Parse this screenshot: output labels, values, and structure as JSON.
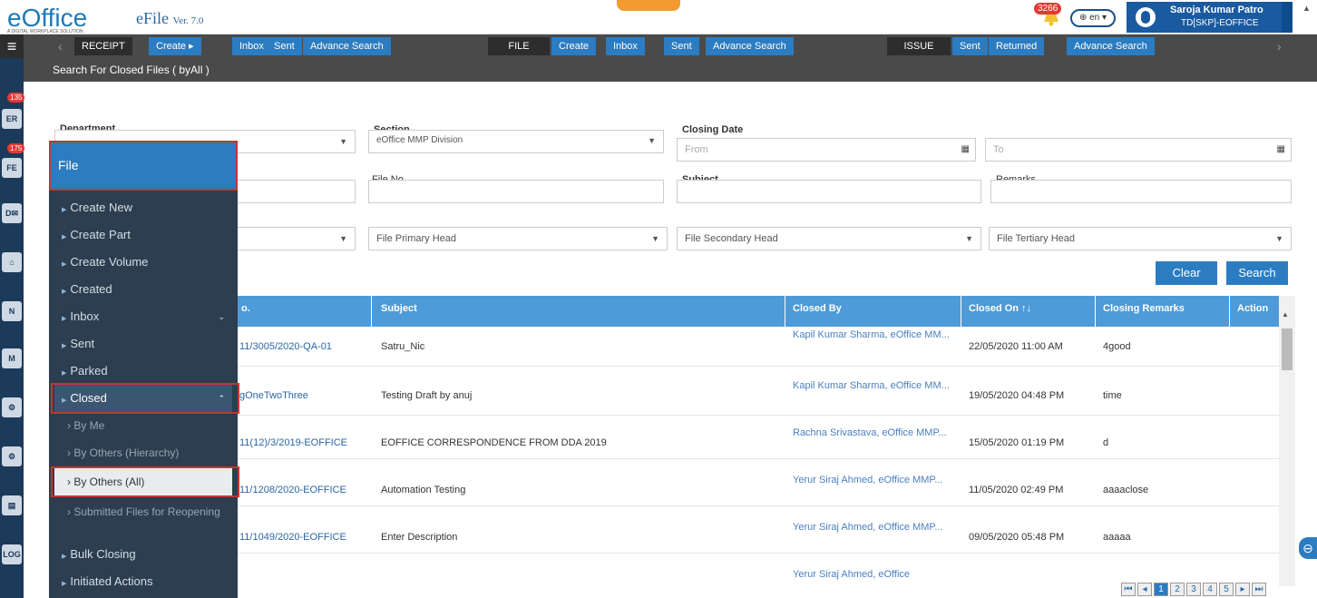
{
  "header": {
    "logo": "eOffice",
    "tagline": "A DIGITAL WORKPLACE SOLUTION",
    "product": "eFile",
    "version": "Ver. 7.0",
    "notification_count": "3266",
    "language": "en",
    "user_name": "Saroja Kumar Patro",
    "user_role": "TD[SKP]-EOFFICE"
  },
  "menubar": {
    "receipt": "RECEIPT",
    "receipt_create": "Create",
    "receipt_inbox": "Inbox",
    "receipt_sent": "Sent",
    "receipt_adv": "Advance Search",
    "file": "FILE",
    "file_create": "Create",
    "file_inbox": "Inbox",
    "file_sent": "Sent",
    "file_adv": "Advance Search",
    "issue": "ISSUE",
    "issue_sent": "Sent",
    "issue_returned": "Returned",
    "issue_adv": "Advance Search"
  },
  "leftstrip": {
    "receipt_badge": "135",
    "file_badge": "175"
  },
  "search": {
    "title": "Search For Closed Files ( byAll )",
    "department_label": "Department",
    "section_label": "Section",
    "section_value": "eOffice MMP Division",
    "closing_date_label": "Closing Date",
    "from_placeholder": "From",
    "to_placeholder": "To",
    "file_no_label": "File No.",
    "subject_label": "Subject",
    "remarks_label": "Remarks",
    "primary_head": "File Primary Head",
    "secondary_head": "File Secondary Head",
    "tertiary_head": "File Tertiary Head",
    "clear": "Clear",
    "search": "Search"
  },
  "table": {
    "col_fileno": "o.",
    "col_subject": "Subject",
    "col_closed_by": "Closed By",
    "col_closed_on": "Closed On ↑↓",
    "col_remarks": "Closing Remarks",
    "col_action": "Action",
    "rows": [
      {
        "fileno": "11/3005/2020-QA-01",
        "subject": "Satru_Nic",
        "closed_by": "Kapil Kumar Sharma, eOffice MM...",
        "closed_on": "22/05/2020 11:00 AM",
        "remarks": "4good"
      },
      {
        "fileno": "gOneTwoThree",
        "subject": "Testing Draft by anuj",
        "closed_by": "Kapil Kumar Sharma, eOffice MM...",
        "closed_on": "19/05/2020 04:48 PM",
        "remarks": "time"
      },
      {
        "fileno": "11(12)/3/2019-EOFFICE",
        "subject": "EOFFICE CORRESPONDENCE FROM DDA 2019",
        "closed_by": "Rachna Srivastava, eOffice MMP...",
        "closed_on": "15/05/2020 01:19 PM",
        "remarks": "d"
      },
      {
        "fileno": "11/1208/2020-EOFFICE",
        "subject": "Automation Testing",
        "closed_by": "Yerur Siraj Ahmed, eOffice MMP...",
        "closed_on": "11/05/2020 02:49 PM",
        "remarks": "aaaaclose"
      },
      {
        "fileno": "11/1049/2020-EOFFICE",
        "subject": "Enter Description",
        "closed_by": "Yerur Siraj Ahmed, eOffice MMP...",
        "closed_on": "09/05/2020 05:48 PM",
        "remarks": "aaaaa"
      },
      {
        "fileno": "",
        "subject": "",
        "closed_by": "Yerur Siraj Ahmed, eOffice",
        "closed_on": "",
        "remarks": ""
      }
    ]
  },
  "pagination": [
    "1",
    "2",
    "3",
    "4",
    "5"
  ],
  "sidemenu": {
    "title": "File",
    "items": [
      "Create New",
      "Create Part",
      "Create Volume",
      "Created",
      "Inbox",
      "Sent",
      "Parked",
      "Closed"
    ],
    "closed_sub": [
      "By Me",
      "By Others (Hierarchy)",
      "By Others (All)",
      "Submitted Files for Reopening"
    ],
    "bulk": "Bulk Closing",
    "initiated": "Initiated Actions"
  }
}
